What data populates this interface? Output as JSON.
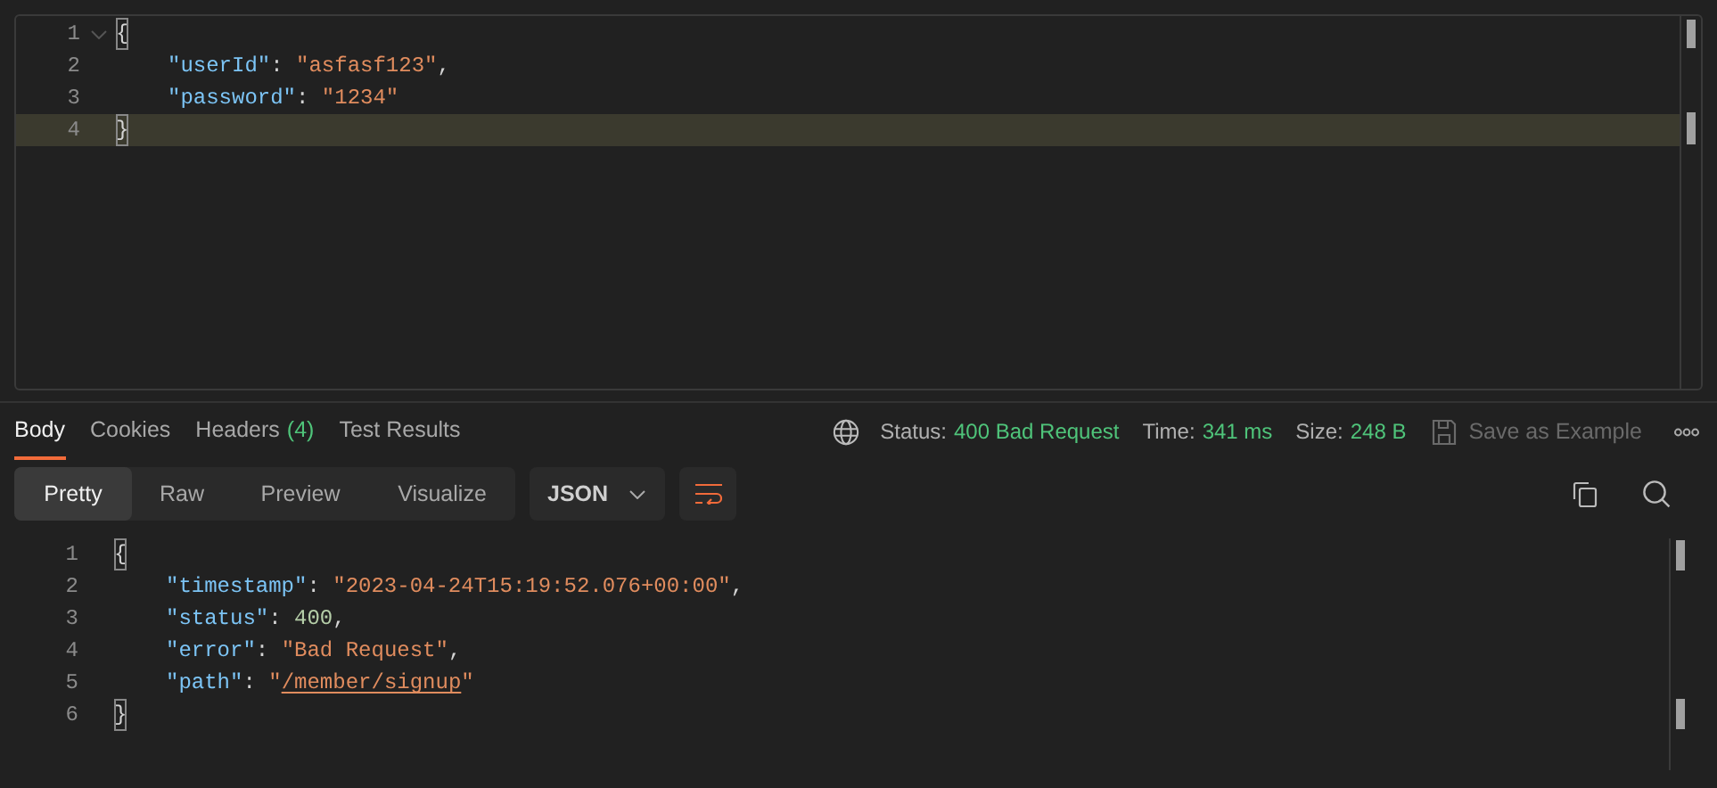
{
  "request_body": {
    "lines": [
      {
        "number": "1",
        "foldable": true,
        "current": false,
        "indent": false,
        "tokens": [
          {
            "kind": "brace",
            "text": "{"
          }
        ]
      },
      {
        "number": "2",
        "foldable": false,
        "current": false,
        "indent": true,
        "tokens": [
          {
            "kind": "key",
            "text": "\"userId\""
          },
          {
            "kind": "punct",
            "text": ": "
          },
          {
            "kind": "string",
            "text": "\"asfasf123\""
          },
          {
            "kind": "punct",
            "text": ","
          }
        ]
      },
      {
        "number": "3",
        "foldable": false,
        "current": false,
        "indent": true,
        "tokens": [
          {
            "kind": "key",
            "text": "\"password\""
          },
          {
            "kind": "punct",
            "text": ": "
          },
          {
            "kind": "string",
            "text": "\"1234\""
          }
        ]
      },
      {
        "number": "4",
        "foldable": false,
        "current": true,
        "indent": false,
        "tokens": [
          {
            "kind": "brace",
            "text": "}"
          }
        ]
      }
    ]
  },
  "response_tabs": [
    {
      "label": "Body",
      "selected": true
    },
    {
      "label": "Cookies",
      "selected": false
    },
    {
      "label": "Headers",
      "count": "(4)",
      "selected": false
    },
    {
      "label": "Test Results",
      "selected": false
    }
  ],
  "response_meta": [
    {
      "label": "Status:",
      "value": "400 Bad Request"
    },
    {
      "label": "Time:",
      "value": "341 ms"
    },
    {
      "label": "Size:",
      "value": "248 B"
    }
  ],
  "save_button": {
    "label": "Save as Example",
    "disabled": true
  },
  "view_modes": [
    {
      "label": "Pretty",
      "selected": true
    },
    {
      "label": "Raw",
      "selected": false
    },
    {
      "label": "Preview",
      "selected": false
    },
    {
      "label": "Visualize",
      "selected": false
    }
  ],
  "format_dropdown": {
    "value": "JSON"
  },
  "response_body": {
    "lines": [
      {
        "number": "1",
        "foldable": false,
        "current": false,
        "indent": false,
        "tokens": [
          {
            "kind": "brace",
            "text": "{"
          }
        ]
      },
      {
        "number": "2",
        "foldable": false,
        "current": false,
        "indent": true,
        "tokens": [
          {
            "kind": "key",
            "text": "\"timestamp\""
          },
          {
            "kind": "punct",
            "text": ": "
          },
          {
            "kind": "string",
            "text": "\"2023-04-24T15:19:52.076+00:00\""
          },
          {
            "kind": "punct",
            "text": ","
          }
        ]
      },
      {
        "number": "3",
        "foldable": false,
        "current": false,
        "indent": true,
        "tokens": [
          {
            "kind": "key",
            "text": "\"status\""
          },
          {
            "kind": "punct",
            "text": ": "
          },
          {
            "kind": "number",
            "text": "400"
          },
          {
            "kind": "punct",
            "text": ","
          }
        ]
      },
      {
        "number": "4",
        "foldable": false,
        "current": false,
        "indent": true,
        "tokens": [
          {
            "kind": "key",
            "text": "\"error\""
          },
          {
            "kind": "punct",
            "text": ": "
          },
          {
            "kind": "string",
            "text": "\"Bad Request\""
          },
          {
            "kind": "punct",
            "text": ","
          }
        ]
      },
      {
        "number": "5",
        "foldable": false,
        "current": false,
        "indent": true,
        "tokens": [
          {
            "kind": "key",
            "text": "\"path\""
          },
          {
            "kind": "punct",
            "text": ": "
          },
          {
            "kind": "string",
            "text": "\""
          },
          {
            "kind": "link",
            "text": "/member/signup"
          },
          {
            "kind": "string",
            "text": "\""
          }
        ]
      },
      {
        "number": "6",
        "foldable": false,
        "current": false,
        "indent": false,
        "tokens": [
          {
            "kind": "brace",
            "text": "}"
          }
        ]
      }
    ]
  }
}
